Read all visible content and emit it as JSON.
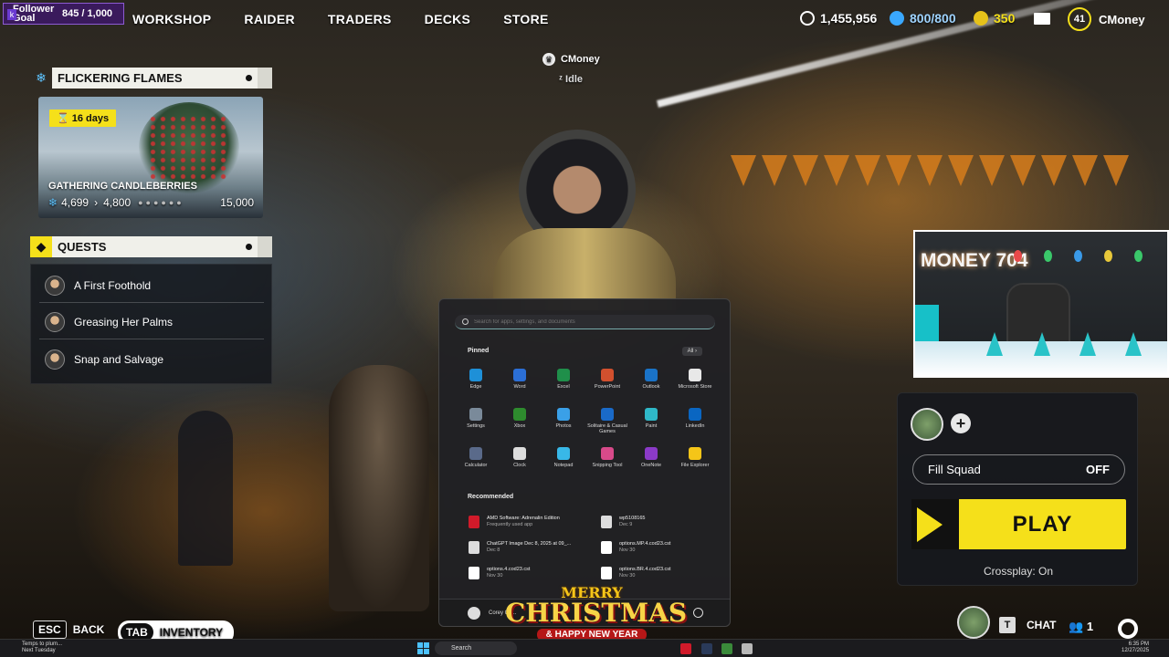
{
  "follower": {
    "label": "Follower Goal",
    "value": "845 / 1,000"
  },
  "nav": [
    "WORKSHOP",
    "RAIDER",
    "TRADERS",
    "DECKS",
    "STORE"
  ],
  "currency": {
    "coins": "1,455,956",
    "energy": "800/800",
    "tokens": "350",
    "level": "41",
    "username": "CMoney"
  },
  "event": {
    "title": "FLICKERING FLAMES",
    "days": "16 days",
    "name": "GATHERING CANDLEBERRIES",
    "current": "4,699",
    "next": "4,800",
    "max": "15,000"
  },
  "quests": {
    "title": "QUESTS",
    "items": [
      "A First Foothold",
      "Greasing Her Palms",
      "Snap and Salvage"
    ]
  },
  "player": {
    "name": "CMoney",
    "status": "Idle"
  },
  "cam": {
    "neon": "MONEY 704"
  },
  "squad": {
    "fill_label": "Fill Squad",
    "fill_value": "OFF",
    "play": "PLAY",
    "crossplay": "Crossplay: On"
  },
  "hints": {
    "back_key": "ESC",
    "back": "BACK",
    "inv_key": "TAB",
    "inventory": "INVENTORY",
    "chat_key": "T",
    "chat": "CHAT",
    "friends": "1"
  },
  "start_menu": {
    "search_placeholder": "Search for apps, settings, and documents",
    "pinned_title": "Pinned",
    "all_label": "All",
    "pinned": [
      {
        "label": "Edge",
        "color": "#1e90d8"
      },
      {
        "label": "Word",
        "color": "#2b6fd6"
      },
      {
        "label": "Excel",
        "color": "#1f8f4a"
      },
      {
        "label": "PowerPoint",
        "color": "#d2502e"
      },
      {
        "label": "Outlook",
        "color": "#1a73c8"
      },
      {
        "label": "Microsoft Store",
        "color": "#e8e8e8"
      },
      {
        "label": "Settings",
        "color": "#7a8a9a"
      },
      {
        "label": "Xbox",
        "color": "#2e8b2e"
      },
      {
        "label": "Photos",
        "color": "#3aa0e8"
      },
      {
        "label": "Solitaire & Casual Games",
        "color": "#1a6ac8"
      },
      {
        "label": "Paint",
        "color": "#2fb8c8"
      },
      {
        "label": "LinkedIn",
        "color": "#0a66c2"
      },
      {
        "label": "Calculator",
        "color": "#5a6a8a"
      },
      {
        "label": "Clock",
        "color": "#dddddd"
      },
      {
        "label": "Notepad",
        "color": "#38b8e8"
      },
      {
        "label": "Snipping Tool",
        "color": "#d84a8a"
      },
      {
        "label": "OneNote",
        "color": "#8b3ac8"
      },
      {
        "label": "File Explorer",
        "color": "#f5c518"
      }
    ],
    "recommended_title": "Recommended",
    "recommended": [
      {
        "name": "AMD Software: Adrenalin Edition",
        "sub": "Frequently used app",
        "color": "#d11a2a"
      },
      {
        "name": "wp5108165",
        "sub": "Dec 9",
        "color": "#dddddd"
      },
      {
        "name": "ChatGPT Image Dec 8, 2025 at 09_...",
        "sub": "Dec 8",
        "color": "#dddddd"
      },
      {
        "name": "options.MP.4.cod23.cst",
        "sub": "Nov 30",
        "color": "#ffffff"
      },
      {
        "name": "options.4.cod23.cst",
        "sub": "Nov 30",
        "color": "#ffffff"
      },
      {
        "name": "options.BR.4.cod23.cst",
        "sub": "Nov 30",
        "color": "#ffffff"
      }
    ],
    "user": "Corey Ca..."
  },
  "xmas": {
    "line1": "MERRY",
    "line2": "CHRISTMAS",
    "line3": "& HAPPY NEW YEAR"
  },
  "taskbar": {
    "weather_line1": "Temps to plum...",
    "weather_line2": "Next Tuesday",
    "search": "Search",
    "time": "6:35 PM",
    "date": "12/27/2025"
  }
}
